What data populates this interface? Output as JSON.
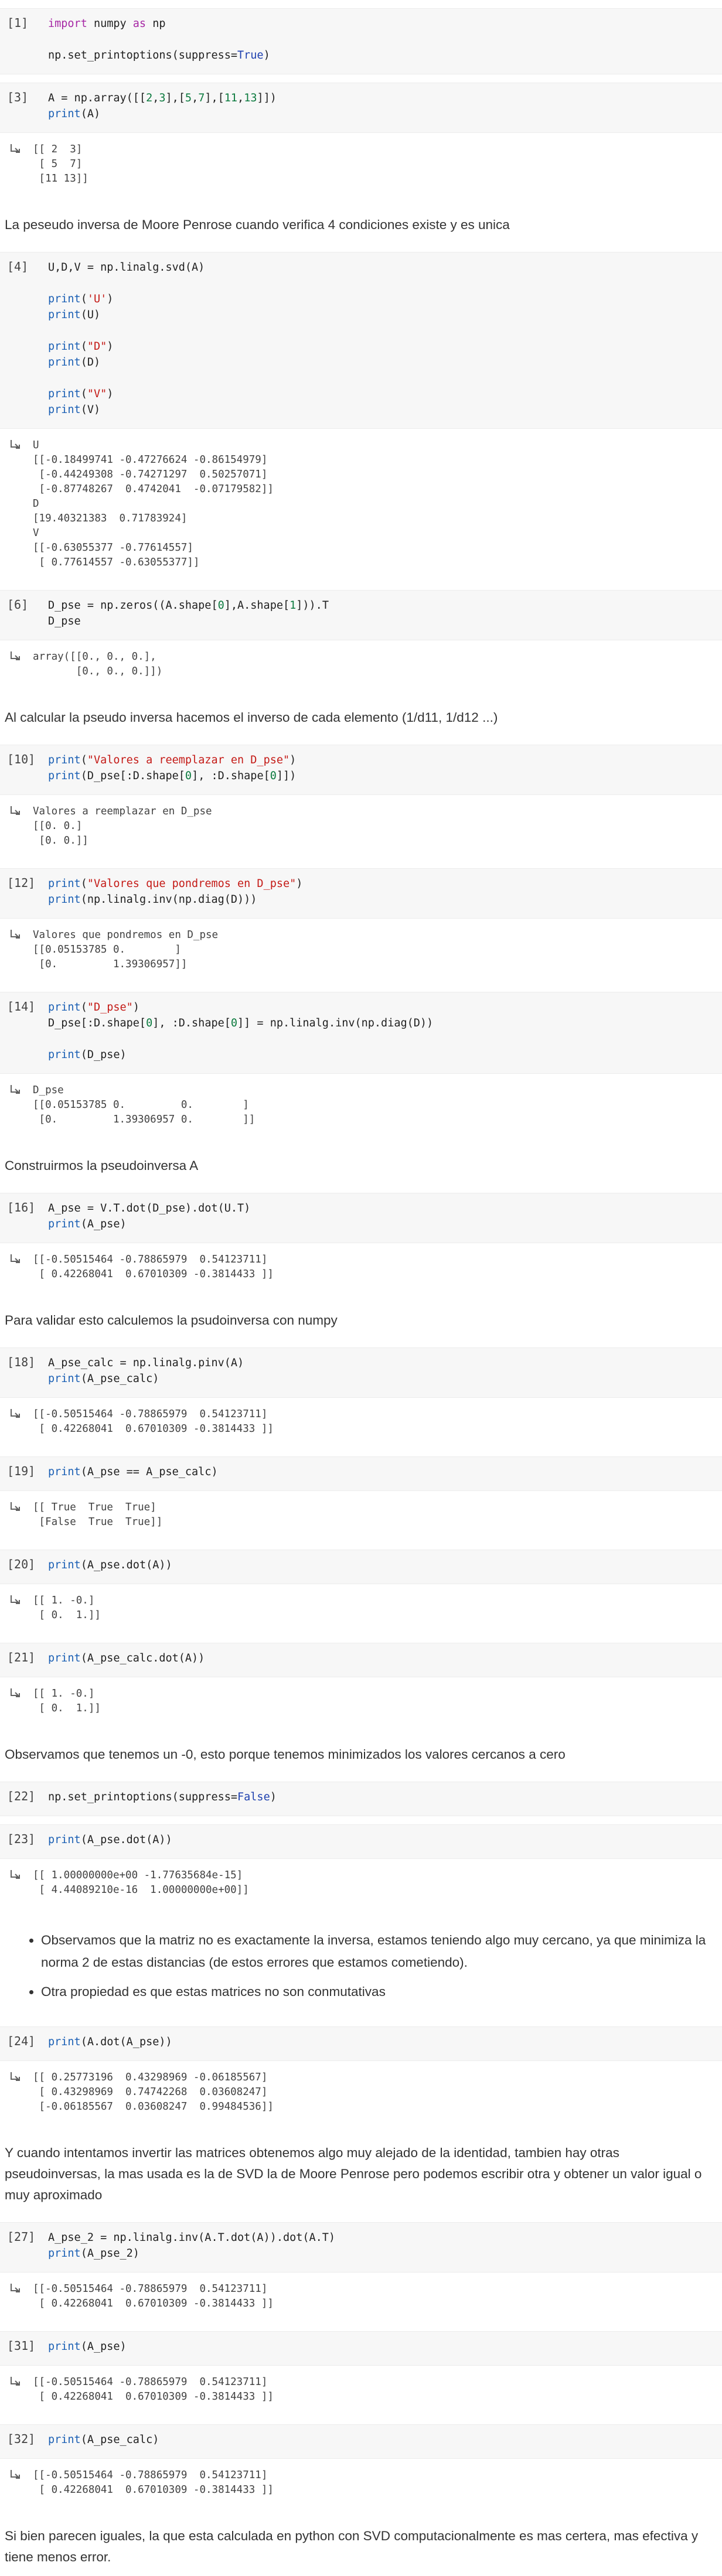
{
  "cells": [
    {
      "type": "code",
      "prompt": "[1]",
      "lines": [
        [
          [
            "import",
            "kw"
          ],
          [
            " numpy ",
            ""
          ],
          [
            "as",
            "kw"
          ],
          [
            " np",
            ""
          ]
        ],
        [
          [
            "",
            ""
          ]
        ],
        [
          [
            "np.set_printoptions(suppress=",
            ""
          ],
          [
            "True",
            "bool"
          ],
          [
            ")",
            ""
          ]
        ]
      ]
    },
    {
      "type": "code",
      "prompt": "[3]",
      "lines": [
        [
          [
            "A = np.array([[",
            ""
          ],
          [
            "2",
            "num"
          ],
          [
            ",",
            ""
          ],
          [
            "3",
            "num"
          ],
          [
            "],[",
            ""
          ],
          [
            "5",
            "num"
          ],
          [
            ",",
            ""
          ],
          [
            "7",
            "num"
          ],
          [
            "],[",
            ""
          ],
          [
            "11",
            "num"
          ],
          [
            ",",
            ""
          ],
          [
            "13",
            "num"
          ],
          [
            "]])",
            ""
          ]
        ],
        [
          [
            "print",
            "fn"
          ],
          [
            "(A)",
            ""
          ]
        ]
      ],
      "output": "[[ 2  3]\n [ 5  7]\n [11 13]]"
    },
    {
      "type": "md",
      "text": "La peseudo inversa de Moore Penrose cuando verifica 4 condiciones existe y es unica"
    },
    {
      "type": "code",
      "prompt": "[4]",
      "lines": [
        [
          [
            "U,D,V = np.linalg.svd(A)",
            ""
          ]
        ],
        [
          [
            "",
            ""
          ]
        ],
        [
          [
            "print",
            "fn"
          ],
          [
            "(",
            ""
          ],
          [
            "'U'",
            "str"
          ],
          [
            ")",
            ""
          ]
        ],
        [
          [
            "print",
            "fn"
          ],
          [
            "(U)",
            ""
          ]
        ],
        [
          [
            "",
            ""
          ]
        ],
        [
          [
            "print",
            "fn"
          ],
          [
            "(",
            ""
          ],
          [
            "\"D\"",
            "str"
          ],
          [
            ")",
            ""
          ]
        ],
        [
          [
            "print",
            "fn"
          ],
          [
            "(D)",
            ""
          ]
        ],
        [
          [
            "",
            ""
          ]
        ],
        [
          [
            "print",
            "fn"
          ],
          [
            "(",
            ""
          ],
          [
            "\"V\"",
            "str"
          ],
          [
            ")",
            ""
          ]
        ],
        [
          [
            "print",
            "fn"
          ],
          [
            "(V)",
            ""
          ]
        ]
      ],
      "output": "U\n[[-0.18499741 -0.47276624 -0.86154979]\n [-0.44249308 -0.74271297  0.50257071]\n [-0.87748267  0.4742041  -0.07179582]]\nD\n[19.40321383  0.71783924]\nV\n[[-0.63055377 -0.77614557]\n [ 0.77614557 -0.63055377]]"
    },
    {
      "type": "code",
      "prompt": "[6]",
      "lines": [
        [
          [
            "D_pse = np.zeros((A.shape[",
            ""
          ],
          [
            "0",
            "num"
          ],
          [
            "],A.shape[",
            ""
          ],
          [
            "1",
            "num"
          ],
          [
            "])).T",
            ""
          ]
        ],
        [
          [
            "D_pse",
            ""
          ]
        ]
      ],
      "output": "array([[0., 0., 0.],\n       [0., 0., 0.]])"
    },
    {
      "type": "md",
      "text": "Al calcular la pseudo inversa hacemos el inverso de cada elemento (1/d11, 1/d12 ...)"
    },
    {
      "type": "code",
      "prompt": "[10]",
      "lines": [
        [
          [
            "print",
            "fn"
          ],
          [
            "(",
            ""
          ],
          [
            "\"Valores a reemplazar en D_pse\"",
            "str"
          ],
          [
            ")",
            ""
          ]
        ],
        [
          [
            "print",
            "fn"
          ],
          [
            "(D_pse[:D.shape[",
            ""
          ],
          [
            "0",
            "num"
          ],
          [
            "], :D.shape[",
            ""
          ],
          [
            "0",
            "num"
          ],
          [
            "]])",
            ""
          ]
        ]
      ],
      "output": "Valores a reemplazar en D_pse\n[[0. 0.]\n [0. 0.]]"
    },
    {
      "type": "code",
      "prompt": "[12]",
      "lines": [
        [
          [
            "print",
            "fn"
          ],
          [
            "(",
            ""
          ],
          [
            "\"Valores que pondremos en D_pse\"",
            "str"
          ],
          [
            ")",
            ""
          ]
        ],
        [
          [
            "print",
            "fn"
          ],
          [
            "(np.linalg.inv(np.diag(D)))",
            ""
          ]
        ]
      ],
      "output": "Valores que pondremos en D_pse\n[[0.05153785 0.        ]\n [0.         1.39306957]]"
    },
    {
      "type": "code",
      "prompt": "[14]",
      "lines": [
        [
          [
            "print",
            "fn"
          ],
          [
            "(",
            ""
          ],
          [
            "\"D_pse\"",
            "str"
          ],
          [
            ")",
            ""
          ]
        ],
        [
          [
            "D_pse[:D.shape[",
            ""
          ],
          [
            "0",
            "num"
          ],
          [
            "], :D.shape[",
            ""
          ],
          [
            "0",
            "num"
          ],
          [
            "]] = np.linalg.inv(np.diag(D))",
            ""
          ]
        ],
        [
          [
            "",
            ""
          ]
        ],
        [
          [
            "print",
            "fn"
          ],
          [
            "(D_pse)",
            ""
          ]
        ]
      ],
      "output": "D_pse\n[[0.05153785 0.         0.        ]\n [0.         1.39306957 0.        ]]"
    },
    {
      "type": "md",
      "text": "Construirmos la pseudoinversa A"
    },
    {
      "type": "code",
      "prompt": "[16]",
      "lines": [
        [
          [
            "A_pse = V.T.dot(D_pse).dot(U.T)",
            ""
          ]
        ],
        [
          [
            "print",
            "fn"
          ],
          [
            "(A_pse)",
            ""
          ]
        ]
      ],
      "output": "[[-0.50515464 -0.78865979  0.54123711]\n [ 0.42268041  0.67010309 -0.3814433 ]]"
    },
    {
      "type": "md",
      "text": "Para validar esto calculemos la psudoinversa con numpy"
    },
    {
      "type": "code",
      "prompt": "[18]",
      "lines": [
        [
          [
            "A_pse_calc = np.linalg.pinv(A)",
            ""
          ]
        ],
        [
          [
            "print",
            "fn"
          ],
          [
            "(A_pse_calc)",
            ""
          ]
        ]
      ],
      "output": "[[-0.50515464 -0.78865979  0.54123711]\n [ 0.42268041  0.67010309 -0.3814433 ]]"
    },
    {
      "type": "code",
      "prompt": "[19]",
      "lines": [
        [
          [
            "print",
            "fn"
          ],
          [
            "(A_pse == A_pse_calc)",
            ""
          ]
        ]
      ],
      "output": "[[ True  True  True]\n [False  True  True]]"
    },
    {
      "type": "code",
      "prompt": "[20]",
      "lines": [
        [
          [
            "print",
            "fn"
          ],
          [
            "(A_pse.dot(A))",
            ""
          ]
        ]
      ],
      "output": "[[ 1. -0.]\n [ 0.  1.]]"
    },
    {
      "type": "code",
      "prompt": "[21]",
      "lines": [
        [
          [
            "print",
            "fn"
          ],
          [
            "(A_pse_calc.dot(A))",
            ""
          ]
        ]
      ],
      "output": "[[ 1. -0.]\n [ 0.  1.]]"
    },
    {
      "type": "md",
      "text": "Observamos que tenemos un -0, esto porque tenemos minimizados los valores cercanos a cero"
    },
    {
      "type": "code",
      "prompt": "[22]",
      "lines": [
        [
          [
            "np.set_printoptions(suppress=",
            ""
          ],
          [
            "False",
            "bool"
          ],
          [
            ")",
            ""
          ]
        ]
      ]
    },
    {
      "type": "code",
      "prompt": "[23]",
      "lines": [
        [
          [
            "print",
            "fn"
          ],
          [
            "(A_pse.dot(A))",
            ""
          ]
        ]
      ],
      "output": "[[ 1.00000000e+00 -1.77635684e-15]\n [ 4.44089210e-16  1.00000000e+00]]"
    },
    {
      "type": "md_list",
      "items": [
        "Observamos que la matriz no es exactamente la inversa, estamos teniendo algo muy cercano, ya que minimiza la norma 2 de estas distancias (de estos errores que estamos cometiendo).",
        "Otra propiedad es que estas matrices no son conmutativas"
      ]
    },
    {
      "type": "code",
      "prompt": "[24]",
      "lines": [
        [
          [
            "print",
            "fn"
          ],
          [
            "(A.dot(A_pse))",
            ""
          ]
        ]
      ],
      "output": "[[ 0.25773196  0.43298969 -0.06185567]\n [ 0.43298969  0.74742268  0.03608247]\n [-0.06185567  0.03608247  0.99484536]]"
    },
    {
      "type": "md",
      "text": "Y cuando intentamos invertir las matrices obtenemos algo muy alejado de la identidad, tambien hay otras pseudoinversas, la mas usada es la de SVD la de Moore Penrose pero podemos escribir otra y obtener un valor igual o muy aproximado"
    },
    {
      "type": "code",
      "prompt": "[27]",
      "lines": [
        [
          [
            "A_pse_2 = np.linalg.inv(A.T.dot(A)).dot(A.T)",
            ""
          ]
        ],
        [
          [
            "print",
            "fn"
          ],
          [
            "(A_pse_2)",
            ""
          ]
        ]
      ],
      "output": "[[-0.50515464 -0.78865979  0.54123711]\n [ 0.42268041  0.67010309 -0.3814433 ]]"
    },
    {
      "type": "code",
      "prompt": "[31]",
      "lines": [
        [
          [
            "print",
            "fn"
          ],
          [
            "(A_pse)",
            ""
          ]
        ]
      ],
      "output": "[[-0.50515464 -0.78865979  0.54123711]\n [ 0.42268041  0.67010309 -0.3814433 ]]"
    },
    {
      "type": "code",
      "prompt": "[32]",
      "lines": [
        [
          [
            "print",
            "fn"
          ],
          [
            "(A_pse_calc)",
            ""
          ]
        ]
      ],
      "output": "[[-0.50515464 -0.78865979  0.54123711]\n [ 0.42268041  0.67010309 -0.3814433 ]]"
    },
    {
      "type": "md",
      "text": "Si bien parecen iguales, la que esta calculada en python con SVD computacionalmente es mas certera, mas efectiva y tiene menos error."
    }
  ],
  "output_icon": "output-arrow-icon"
}
